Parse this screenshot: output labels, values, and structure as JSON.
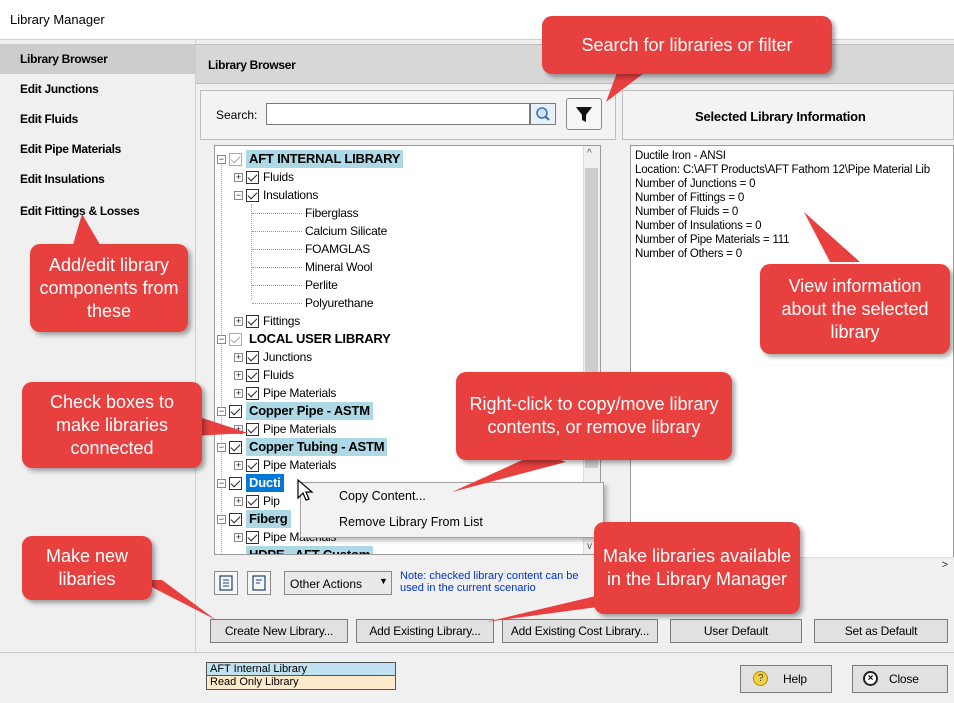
{
  "window": {
    "title": "Library Manager"
  },
  "sidebar": {
    "items": [
      {
        "label": "Library Browser"
      },
      {
        "label": "Edit Junctions"
      },
      {
        "label": "Edit Fluids"
      },
      {
        "label": "Edit Pipe Materials"
      },
      {
        "label": "Edit Insulations"
      },
      {
        "label": "Edit Fittings & Losses"
      }
    ]
  },
  "browser": {
    "header": "Library Browser",
    "search_label": "Search:",
    "search_value": "",
    "other_actions": "Other Actions",
    "note": "Note: checked library content can be used in the current scenario"
  },
  "tree": {
    "items": [
      "AFT INTERNAL LIBRARY",
      "Fluids",
      "Insulations",
      "Fiberglass",
      "Calcium Silicate",
      "FOAMGLAS",
      "Mineral Wool",
      "Perlite",
      "Polyurethane",
      "Fittings",
      "LOCAL USER LIBRARY",
      "Junctions",
      "Fluids",
      "Pipe Materials",
      "Copper Pipe - ASTM",
      "Pipe Materials",
      "Copper Tubing - ASTM",
      "Pipe Materials",
      "Ducti",
      "Pip",
      "Fiberg",
      "Pipe Materials",
      "HDPE - AFT Custom"
    ]
  },
  "context_menu": {
    "items": [
      "Copy Content...",
      "Remove Library From List"
    ]
  },
  "info": {
    "header": "Selected Library Information",
    "lines": [
      "Ductile Iron - ANSI",
      "Location: C:\\AFT Products\\AFT Fathom 12\\Pipe Material Lib",
      "Number of Junctions = 0",
      "Number of Fittings = 0",
      "Number of Fluids = 0",
      "Number of Insulations = 0",
      "Number of Pipe Materials = 111",
      "Number of Others = 0"
    ]
  },
  "buttons": {
    "create_new": "Create New Library...",
    "add_existing": "Add Existing Library...",
    "add_existing_cost": "Add Existing Cost Library...",
    "user_default": "User Default",
    "set_default": "Set as Default",
    "help": "Help",
    "close": "Close"
  },
  "legend": {
    "internal": "AFT Internal Library",
    "read_only": "Read Only Library"
  },
  "callouts": {
    "search": "Search for libraries or filter",
    "edit": "Add/edit library components from these",
    "info": "View information about the selected library",
    "checkboxes": "Check boxes to make libraries connected",
    "rightclick": "Right-click to copy/move library contents, or remove library",
    "new": "Make new libaries",
    "available": "Make libraries available in the Library Manager"
  },
  "colors": {
    "callout": "#e8403f",
    "library_highlight": "#add8e6",
    "selection": "#0078d7",
    "read_only": "#ffeacc"
  }
}
